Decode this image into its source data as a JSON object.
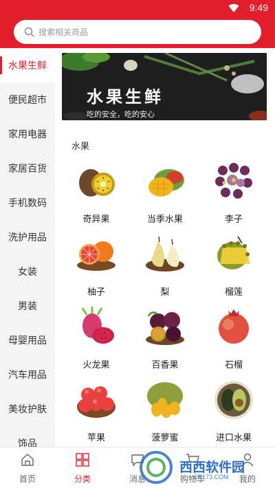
{
  "status_bar": {
    "time": "9:49"
  },
  "search": {
    "placeholder": "搜索相关商品"
  },
  "sidebar": {
    "items": [
      {
        "label": "水果生鲜",
        "active": true
      },
      {
        "label": "便民超市"
      },
      {
        "label": "家用电器"
      },
      {
        "label": "家居百货"
      },
      {
        "label": "手机数码"
      },
      {
        "label": "洗护用品"
      },
      {
        "label": "女装"
      },
      {
        "label": "男装"
      },
      {
        "label": "母婴用品"
      },
      {
        "label": "汽车用品"
      },
      {
        "label": "美妆护肤"
      },
      {
        "label": "饰品"
      }
    ]
  },
  "banner": {
    "title": "水果生鲜",
    "subtitle": "吃的安全，吃的安心"
  },
  "section_title": "水果",
  "products": [
    {
      "name": "奇异果",
      "icon": "kiwi"
    },
    {
      "name": "当季水果",
      "icon": "mango"
    },
    {
      "name": "李子",
      "icon": "plum"
    },
    {
      "name": "柚子",
      "icon": "grapefruit"
    },
    {
      "name": "梨",
      "icon": "pear"
    },
    {
      "name": "榴莲",
      "icon": "durian"
    },
    {
      "name": "火龙果",
      "icon": "dragon-fruit"
    },
    {
      "name": "百香果",
      "icon": "passion-fruit"
    },
    {
      "name": "石榴",
      "icon": "pomegranate"
    },
    {
      "name": "苹果",
      "icon": "apple"
    },
    {
      "name": "菠萝蜜",
      "icon": "jackfruit"
    },
    {
      "name": "进口水果",
      "icon": "avocado"
    }
  ],
  "tabbar": {
    "items": [
      {
        "label": "首页",
        "icon": "home-icon"
      },
      {
        "label": "分类",
        "icon": "category-icon",
        "active": true
      },
      {
        "label": "消息",
        "icon": "message-icon"
      },
      {
        "label": "购物车",
        "icon": "cart-icon"
      },
      {
        "label": "我的",
        "icon": "user-icon"
      }
    ]
  },
  "watermark": {
    "text": "西西软件园",
    "url": "CR173.COM"
  },
  "colors": {
    "accent": "#e21d2c",
    "sidebar_bg": "#f4f4f4"
  }
}
